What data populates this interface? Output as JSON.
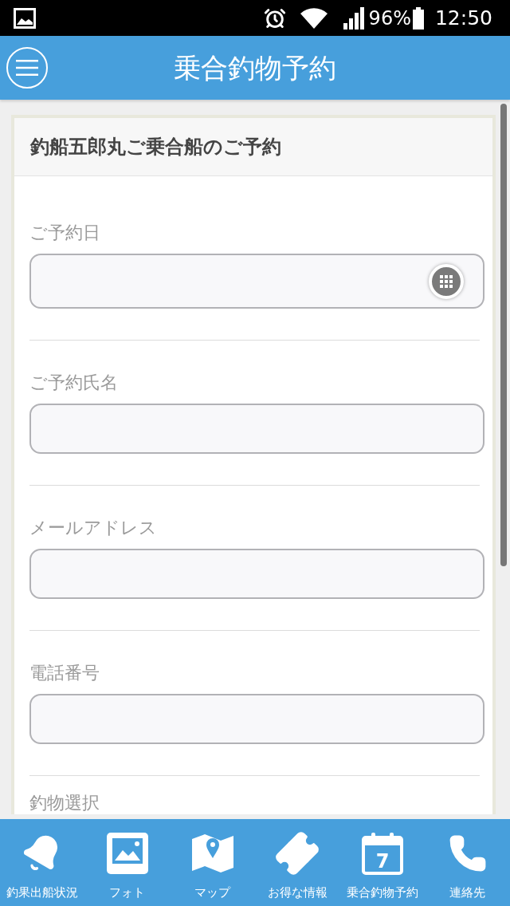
{
  "status_bar": {
    "battery": "96%",
    "time": "12:50"
  },
  "header": {
    "title": "乗合釣物予約"
  },
  "form": {
    "title": "釣船五郎丸ご乗合船のご予約",
    "fields": [
      {
        "kind": "date",
        "label": "ご予約日"
      },
      {
        "kind": "text",
        "label": "ご予約氏名"
      },
      {
        "kind": "text",
        "label": "メールアドレス"
      },
      {
        "kind": "text",
        "label": "電話番号"
      },
      {
        "kind": "select",
        "label": "釣物選択"
      }
    ]
  },
  "tab_bar": {
    "items": [
      {
        "label": "釣果出船状況"
      },
      {
        "label": "フォト"
      },
      {
        "label": "マップ"
      },
      {
        "label": "お得な情報"
      },
      {
        "label": "乗合釣物予約",
        "icon_text": "7"
      },
      {
        "label": "連絡先"
      }
    ]
  }
}
